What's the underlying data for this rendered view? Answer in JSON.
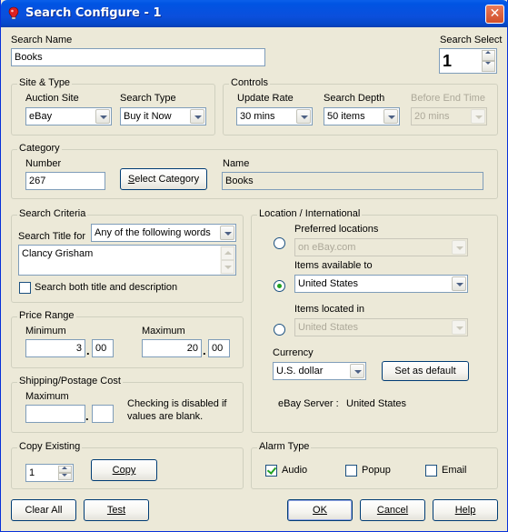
{
  "window": {
    "title": "Search Configure - 1",
    "close_glyph": "✕",
    "icon": "app-icon"
  },
  "search_name": {
    "label": "Search Name",
    "value": "Books"
  },
  "search_select": {
    "label": "Search Select",
    "value": "1"
  },
  "site_type": {
    "title": "Site & Type",
    "auction_site_label": "Auction Site",
    "auction_site_value": "eBay",
    "search_type_label": "Search Type",
    "search_type_value": "Buy it Now"
  },
  "controls": {
    "title": "Controls",
    "update_rate_label": "Update Rate",
    "update_rate_value": "30 mins",
    "search_depth_label": "Search Depth",
    "search_depth_value": "50 items",
    "before_end_label": "Before End Time",
    "before_end_value": "20 mins"
  },
  "category": {
    "title": "Category",
    "number_label": "Number",
    "number_value": "267",
    "button_prefix": "S",
    "button_rest": "elect Category",
    "name_label": "Name",
    "name_value": "Books"
  },
  "search_criteria": {
    "title": "Search Criteria",
    "title_for_label": "Search Title for",
    "mode_value": "Any of the following words",
    "terms": "Clancy Grisham",
    "both_label": "Search both title and description",
    "both_checked": false
  },
  "price_range": {
    "title": "Price Range",
    "min_label": "Minimum",
    "min_whole": "3",
    "min_cents": "00",
    "max_label": "Maximum",
    "max_whole": "20",
    "max_cents": "00",
    "dot": "."
  },
  "shipping": {
    "title": "Shipping/Postage Cost",
    "max_label": "Maximum",
    "max_whole": "",
    "max_cents": "",
    "note": "Checking is disabled if values are blank.",
    "dot": "."
  },
  "location": {
    "title": "Location / International",
    "preferred_label": "Preferred locations",
    "preferred_value": "on eBay.com",
    "available_label": "Items available to",
    "available_value": "United States",
    "located_label": "Items located in",
    "located_value": "United States",
    "currency_label": "Currency",
    "currency_value": "U.S. dollar",
    "set_default_label": "Set as default",
    "server_label": "eBay Server :",
    "server_value": "United States",
    "selected_option": "available"
  },
  "copy_existing": {
    "title": "Copy Existing",
    "value": "1",
    "button_label": "Copy"
  },
  "alarm_type": {
    "title": "Alarm Type",
    "audio_label": "Audio",
    "audio_checked": true,
    "popup_label": "Popup",
    "popup_checked": false,
    "email_label": "Email",
    "email_checked": false
  },
  "footer": {
    "clear_all": "Clear All",
    "test": "Test",
    "ok": "OK",
    "cancel": "Cancel",
    "help": "Help"
  }
}
